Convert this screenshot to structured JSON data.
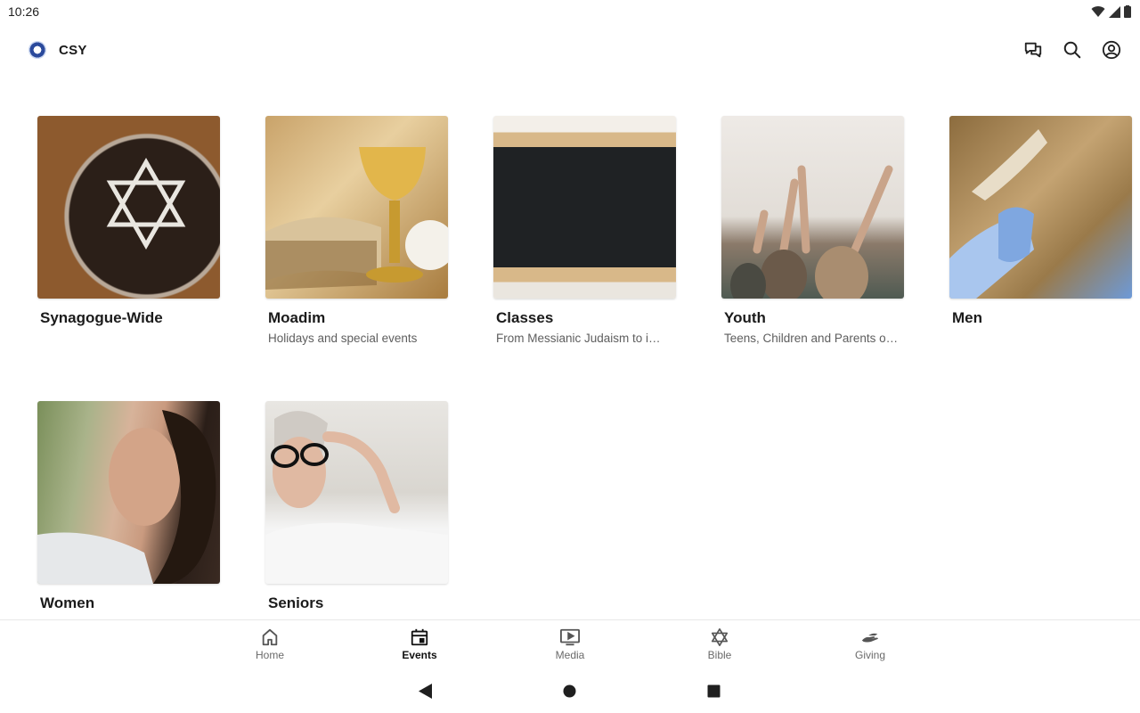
{
  "status_bar": {
    "time": "10:26"
  },
  "app_bar": {
    "title": "CSY"
  },
  "categories": [
    {
      "title": "Synagogue-Wide",
      "subtitle": ""
    },
    {
      "title": "Moadim",
      "subtitle": "Holidays and special events"
    },
    {
      "title": "Classes",
      "subtitle": "From Messianic Judaism to i…"
    },
    {
      "title": "Youth",
      "subtitle": "Teens, Children and Parents of…"
    },
    {
      "title": "Men",
      "subtitle": ""
    },
    {
      "title": "Women",
      "subtitle": ""
    },
    {
      "title": "Seniors",
      "subtitle": ""
    }
  ],
  "bottom_nav": {
    "items": [
      {
        "label": "Home",
        "icon": "home-icon"
      },
      {
        "label": "Events",
        "icon": "calendar-icon",
        "active": true
      },
      {
        "label": "Media",
        "icon": "tv-play-icon"
      },
      {
        "label": "Bible",
        "icon": "star-of-david-icon"
      },
      {
        "label": "Giving",
        "icon": "giving-hand-icon"
      }
    ]
  },
  "colors": {
    "text": "#1b1b1b",
    "subtext": "#5e5e5e",
    "nav_inactive": "#6a6a6a"
  }
}
